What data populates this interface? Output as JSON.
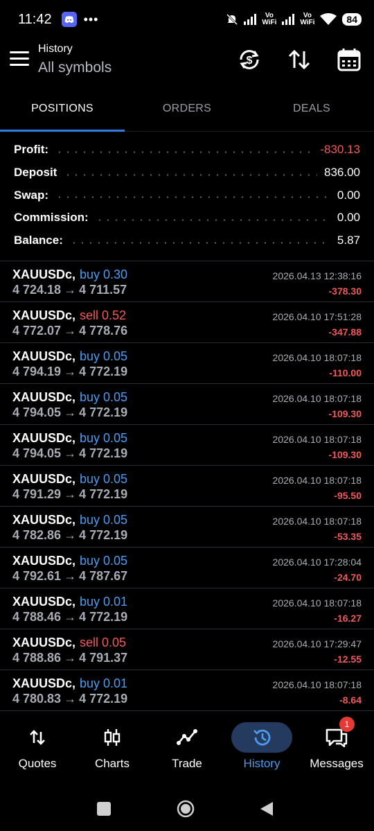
{
  "status_bar": {
    "time": "11:42",
    "dots": "•••",
    "battery": "84",
    "vowifi_1": "Vo\nWiFi",
    "vowifi_2": "Vo\nWiFi"
  },
  "header": {
    "title": "History",
    "subtitle": "All symbols"
  },
  "tabs": [
    {
      "label": "POSITIONS",
      "active": true
    },
    {
      "label": "ORDERS",
      "active": false
    },
    {
      "label": "DEALS",
      "active": false
    }
  ],
  "summary": [
    {
      "label": "Profit:",
      "value": "-830.13"
    },
    {
      "label": "Deposit",
      "value": "836.00"
    },
    {
      "label": "Swap:",
      "value": "0.00"
    },
    {
      "label": "Commission:",
      "value": "0.00"
    },
    {
      "label": "Balance:",
      "value": "5.87"
    }
  ],
  "positions": [
    {
      "symbol": "XAUUSDc,",
      "side": "buy 0.30",
      "open": "4 724.18",
      "close": "4 711.57",
      "time": "2026.04.13 12:38:16",
      "profit": "-378.30"
    },
    {
      "symbol": "XAUUSDc,",
      "side": "sell 0.52",
      "open": "4 772.07",
      "close": "4 778.76",
      "time": "2026.04.10 17:51:28",
      "profit": "-347.88"
    },
    {
      "symbol": "XAUUSDc,",
      "side": "buy 0.05",
      "open": "4 794.19",
      "close": "4 772.19",
      "time": "2026.04.10 18:07:18",
      "profit": "-110.00"
    },
    {
      "symbol": "XAUUSDc,",
      "side": "buy 0.05",
      "open": "4 794.05",
      "close": "4 772.19",
      "time": "2026.04.10 18:07:18",
      "profit": "-109.30"
    },
    {
      "symbol": "XAUUSDc,",
      "side": "buy 0.05",
      "open": "4 794.05",
      "close": "4 772.19",
      "time": "2026.04.10 18:07:18",
      "profit": "-109.30"
    },
    {
      "symbol": "XAUUSDc,",
      "side": "buy 0.05",
      "open": "4 791.29",
      "close": "4 772.19",
      "time": "2026.04.10 18:07:18",
      "profit": "-95.50"
    },
    {
      "symbol": "XAUUSDc,",
      "side": "buy 0.05",
      "open": "4 782.86",
      "close": "4 772.19",
      "time": "2026.04.10 18:07:18",
      "profit": "-53.35"
    },
    {
      "symbol": "XAUUSDc,",
      "side": "buy 0.05",
      "open": "4 792.61",
      "close": "4 787.67",
      "time": "2026.04.10 17:28:04",
      "profit": "-24.70"
    },
    {
      "symbol": "XAUUSDc,",
      "side": "buy 0.01",
      "open": "4 788.46",
      "close": "4 772.19",
      "time": "2026.04.10 18:07:18",
      "profit": "-16.27"
    },
    {
      "symbol": "XAUUSDc,",
      "side": "sell 0.05",
      "open": "4 788.86",
      "close": "4 791.37",
      "time": "2026.04.10 17:29:47",
      "profit": "-12.55"
    },
    {
      "symbol": "XAUUSDc,",
      "side": "buy 0.01",
      "open": "4 780.83",
      "close": "4 772.19",
      "time": "2026.04.10 18:07:18",
      "profit": "-8.64"
    }
  ],
  "arrow": "→",
  "bottom_nav": [
    {
      "label": "Quotes",
      "icon": "quotes-icon"
    },
    {
      "label": "Charts",
      "icon": "charts-icon"
    },
    {
      "label": "Trade",
      "icon": "trade-icon"
    },
    {
      "label": "History",
      "icon": "history-icon",
      "active": true
    },
    {
      "label": "Messages",
      "icon": "messages-icon",
      "badge": "1"
    }
  ],
  "colors": {
    "accent": "#2f7fe0",
    "buy": "#4d9cf0",
    "sell": "#f05a5a",
    "loss": "#f05a5a",
    "background": "#000000"
  }
}
